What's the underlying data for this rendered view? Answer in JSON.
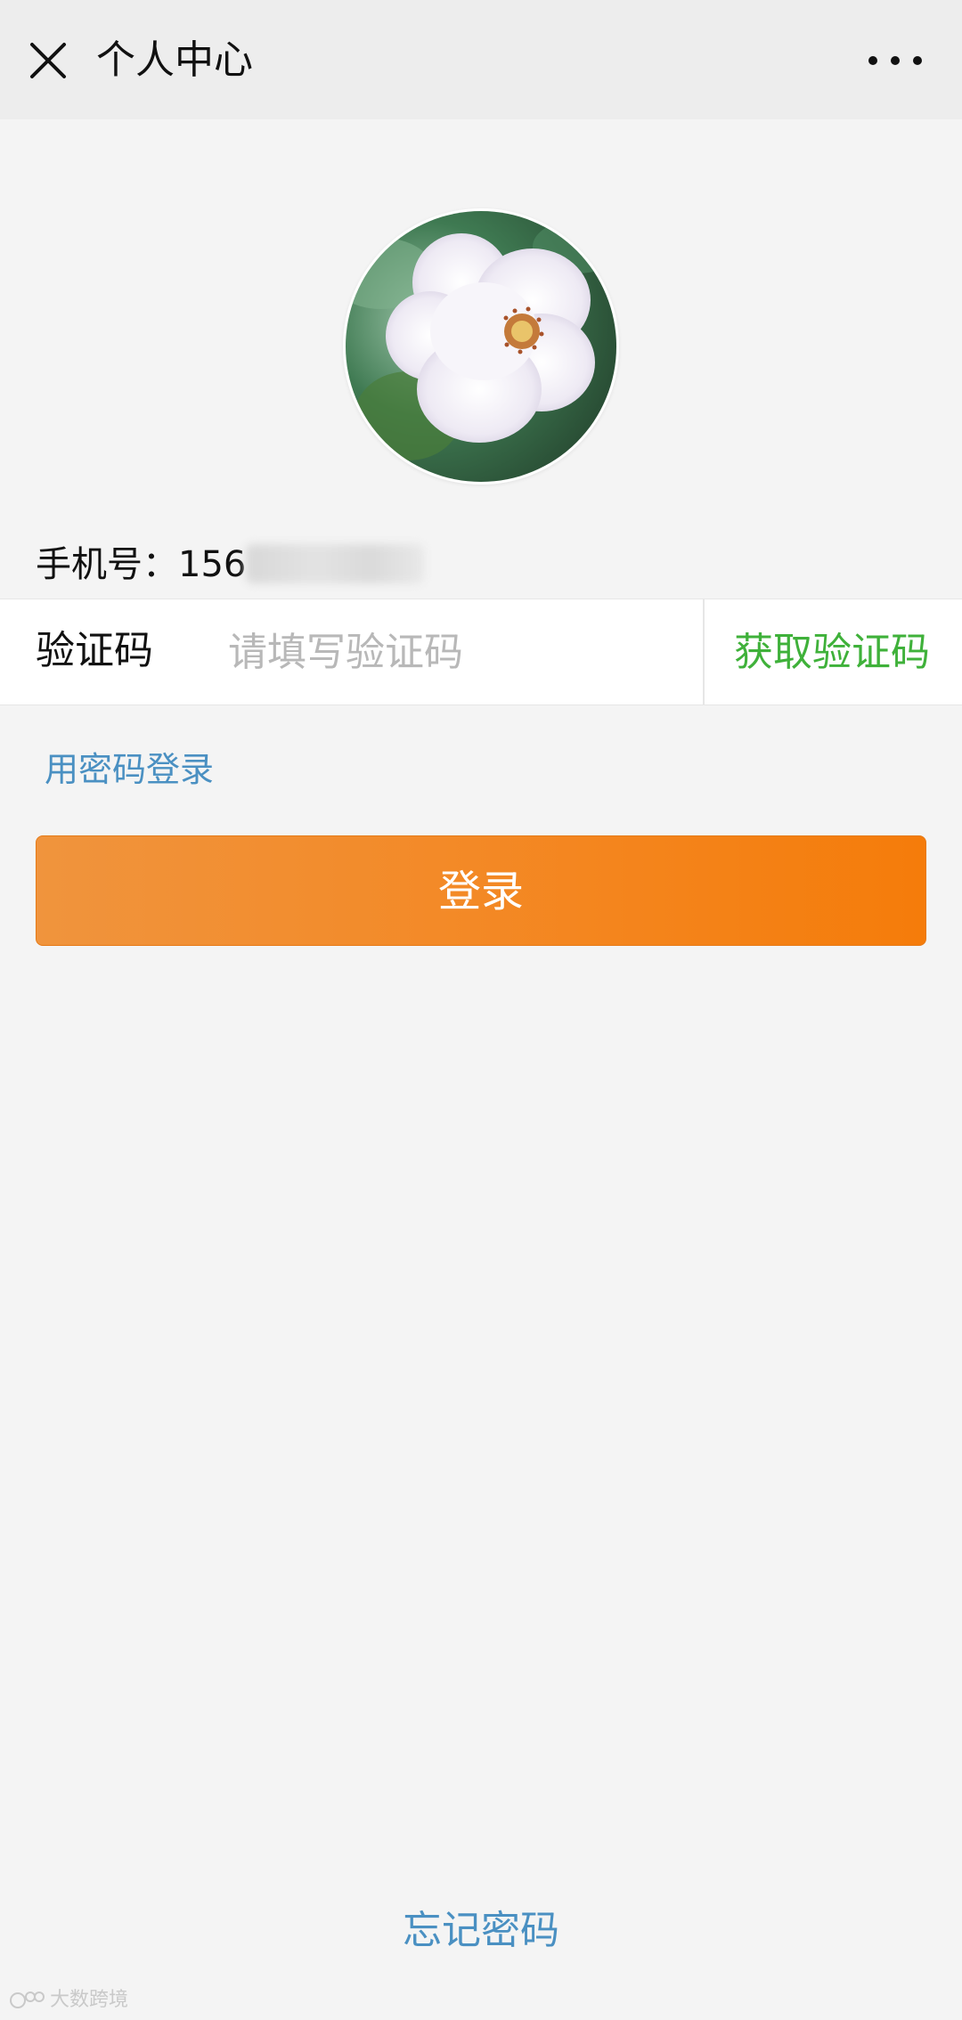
{
  "header": {
    "title": "个人中心",
    "close_icon": "close-icon",
    "more_icon": "more-icon"
  },
  "account": {
    "phone_label": "手机号：",
    "phone_visible": "156"
  },
  "verify": {
    "label": "验证码",
    "placeholder": "请填写验证码",
    "get_code_label": "获取验证码",
    "get_code_color": "#3fb13a"
  },
  "links": {
    "password_login": "用密码登录",
    "forgot_password": "忘记密码",
    "link_color": "#4a90c2"
  },
  "login_button": {
    "label": "登录",
    "color": "#f38a28"
  },
  "watermark": {
    "text": "大数跨境"
  }
}
